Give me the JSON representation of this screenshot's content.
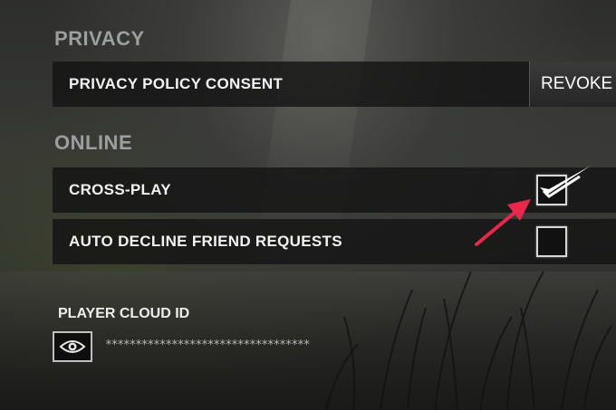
{
  "privacy": {
    "title": "PRIVACY",
    "policy_label": "PRIVACY POLICY CONSENT",
    "revoke_label": "REVOKE"
  },
  "online": {
    "title": "ONLINE",
    "crossplay_label": "CROSS-PLAY",
    "crossplay_checked": true,
    "auto_decline_label": "AUTO DECLINE FRIEND REQUESTS",
    "auto_decline_checked": false
  },
  "cloud": {
    "label": "PLAYER CLOUD ID",
    "masked_value": "**********************************",
    "eye_icon": "eye-icon"
  },
  "colors": {
    "annotation_arrow": "#e8284a",
    "section_title": "#9c9ea0"
  }
}
